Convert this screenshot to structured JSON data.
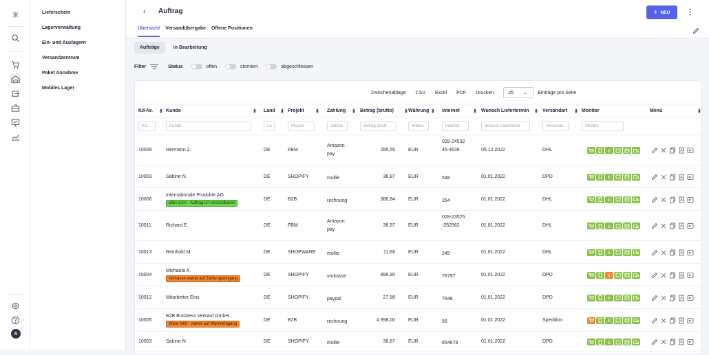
{
  "sidebar": {
    "items": [
      "Lieferschein",
      "Lagerverwaltung",
      "Ein- und Auslagern",
      "Versandzentrum",
      "Paket Annahme",
      "Mobiles Lager"
    ]
  },
  "rail": {
    "icons": [
      "logo-icon",
      "search-icon",
      "cart-icon",
      "warehouse-icon",
      "return-icon",
      "package-icon",
      "screen-icon",
      "chart-icon",
      "settings-icon",
      "help-icon"
    ],
    "avatar": "A"
  },
  "header": {
    "back": "‹",
    "title": "Auftrag",
    "new_label": "NEU",
    "kebab": "⋮"
  },
  "tabs": [
    "Übersicht",
    "Versandübergabe",
    "Offene Positionen"
  ],
  "subtabs": [
    "Aufträge",
    "in Bearbeitung"
  ],
  "filters": {
    "label": "Filter",
    "status_label": "Status",
    "options": [
      "offen",
      "storniert",
      "abgeschlossen"
    ]
  },
  "toolbar": {
    "buttons": [
      "Zwischenablage",
      "CSV",
      "Excel",
      "PDF",
      "Drucken"
    ],
    "page_size": "25",
    "page_size_suffix": "Einträge pro Seite"
  },
  "columns": [
    "Kd-Nr.",
    "Kunde",
    "Land",
    "Projekt",
    "Zahlung",
    "Betrag (brutto)",
    "Währung",
    "Internet",
    "Wunsch Liefertermin",
    "Versandart",
    "Monitor",
    "Menü"
  ],
  "filter_placeholders": [
    "Kd-",
    "Kunde",
    "La",
    "Projekt",
    "Zahlun",
    "Betrag (brutt",
    "Währu",
    "Internet",
    "Wunsch Liefertermi",
    "Versanda",
    "Monitor"
  ],
  "rows": [
    {
      "kd": "10009",
      "kunde": "Hermann Z.",
      "badge": "",
      "land": "DE",
      "projekt": "FBM",
      "zahlung": "Amazon pay",
      "betrag": "285,55",
      "waehrung": "EUR",
      "internet": "028-2453245-4636",
      "termin": "05.12.2022",
      "versand": "DHL"
    },
    {
      "kd": "10003",
      "kunde": "Sabine N.",
      "badge": "",
      "land": "DE",
      "projekt": "SHOPIFY",
      "zahlung": "mollie",
      "betrag": "36,87",
      "waehrung": "EUR",
      "internet": "548",
      "termin": "01.01.2022",
      "versand": "DPD"
    },
    {
      "kd": "10006",
      "kunde": "Internationale Produkte AG",
      "badge": "alles grün - Auftrag ist versandbereit",
      "land": "DE",
      "projekt": "B2B",
      "zahlung": "rechnung",
      "betrag": "386,84",
      "waehrung": "EUR",
      "internet": "264",
      "termin": "01.01.2022",
      "versand": "DHL"
    },
    {
      "kd": "10011",
      "kunde": "Richard E.",
      "badge": "",
      "land": "DE",
      "projekt": "FBM",
      "zahlung": "Amazon pay",
      "betrag": "36,97",
      "waehrung": "EUR",
      "internet": "028-23525-252562",
      "termin": "01.01.2022",
      "versand": "DHL"
    },
    {
      "kd": "10013",
      "kunde": "Reinhold M.",
      "badge": "",
      "land": "DE",
      "projekt": "SHOPWARE",
      "zahlung": "mollie",
      "betrag": "11,88",
      "waehrung": "EUR",
      "internet": "245",
      "termin": "01.01.2022",
      "versand": "DHL"
    },
    {
      "kd": "10004",
      "kunde": "Michaela A.",
      "badge": "Vorkasse wartet auf Zahlungseingang",
      "land": "DE",
      "projekt": "SHOPIFY",
      "zahlung": "vorkasse",
      "betrag": "899,90",
      "waehrung": "EUR",
      "internet": "78797",
      "termin": "01.01.2022",
      "versand": "DPD"
    },
    {
      "kd": "10012",
      "kunde": "Mitarbeiter Eins",
      "badge": "",
      "land": "DE",
      "projekt": "SHOPIFY",
      "zahlung": "paypal",
      "betrag": "27,98",
      "waehrung": "EUR",
      "internet": "7648",
      "termin": "01.01.2022",
      "versand": "DPD"
    },
    {
      "kd": "10005",
      "kunde": "B2B Business Verkauf GmbH",
      "badge": "Ware fehlt - wartet auf Wareneingang",
      "land": "DE",
      "projekt": "B2B",
      "zahlung": "rechnung",
      "betrag": "4.998,00",
      "waehrung": "EUR",
      "internet": "56",
      "termin": "01.01.2022",
      "versand": "Spedition"
    },
    {
      "kd": "10003",
      "kunde": "Sabine N.",
      "badge": "",
      "land": "DE",
      "projekt": "SHOPIFY",
      "zahlung": "mollie",
      "betrag": "36,87",
      "waehrung": "EUR",
      "internet": "654678",
      "termin": "01.01.2022",
      "versand": "DPD"
    }
  ],
  "colors": {
    "accent": "#5562e8",
    "monitor_green": "#8bc34a",
    "monitor_orange": "#f08a32"
  }
}
